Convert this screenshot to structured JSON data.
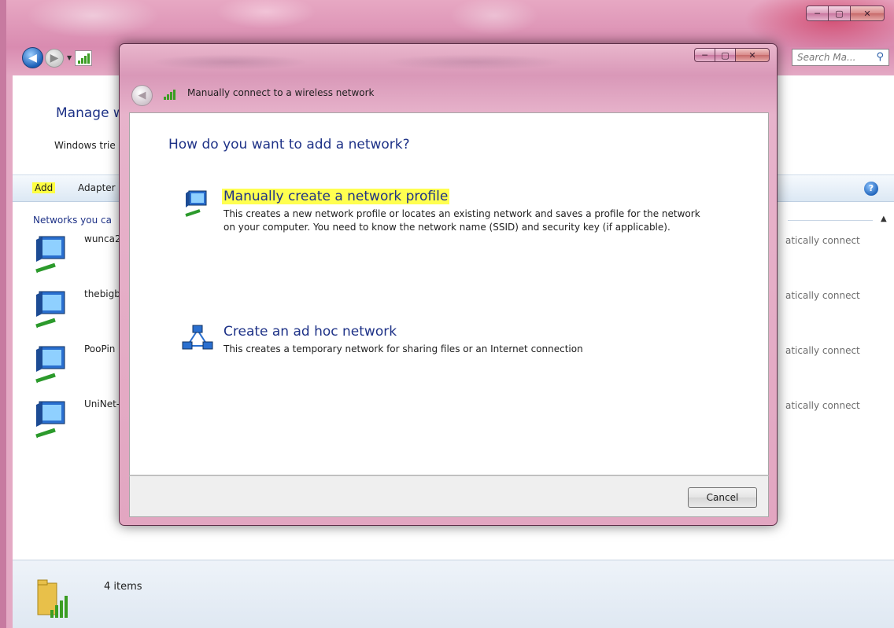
{
  "background_window": {
    "search": {
      "placeholder": "Search Ma..."
    },
    "title": "Manage w",
    "description": "Windows trie",
    "toolbar": {
      "add_label": "Add",
      "adapter_label": "Adapter"
    },
    "group_header": "Networks you ca",
    "networks": [
      {
        "name": "wunca2",
        "connection": "atically connect"
      },
      {
        "name": "thebigb",
        "connection": "atically connect"
      },
      {
        "name": "PooPin",
        "connection": "atically connect"
      },
      {
        "name": "UniNet-",
        "connection": "atically connect"
      }
    ],
    "status": {
      "items_count": "4 items"
    }
  },
  "dialog": {
    "title": "Manually connect to a wireless network",
    "question": "How do you want to add a network?",
    "options": [
      {
        "title": "Manually create a network profile",
        "description": "This creates a new network profile or locates an existing network and saves a profile for the network on your computer. You need to know the network name (SSID) and security key (if applicable).",
        "highlighted": true
      },
      {
        "title": "Create an ad hoc network",
        "description": "This creates a temporary network for sharing files or an Internet connection",
        "highlighted": false
      }
    ],
    "cancel_label": "Cancel"
  },
  "colors": {
    "aero_frame": "#e2a6c1",
    "heading_blue": "#1e3287",
    "highlight_yellow": "#ffff50",
    "signal_green": "#3b9d23"
  },
  "icons": {
    "back": "back-arrow-icon",
    "forward": "forward-arrow-icon",
    "search": "search-icon",
    "help": "help-icon",
    "network": "wireless-network-icon",
    "adhoc": "adhoc-network-icon",
    "folder": "network-folder-icon",
    "signal": "signal-bars-icon"
  }
}
